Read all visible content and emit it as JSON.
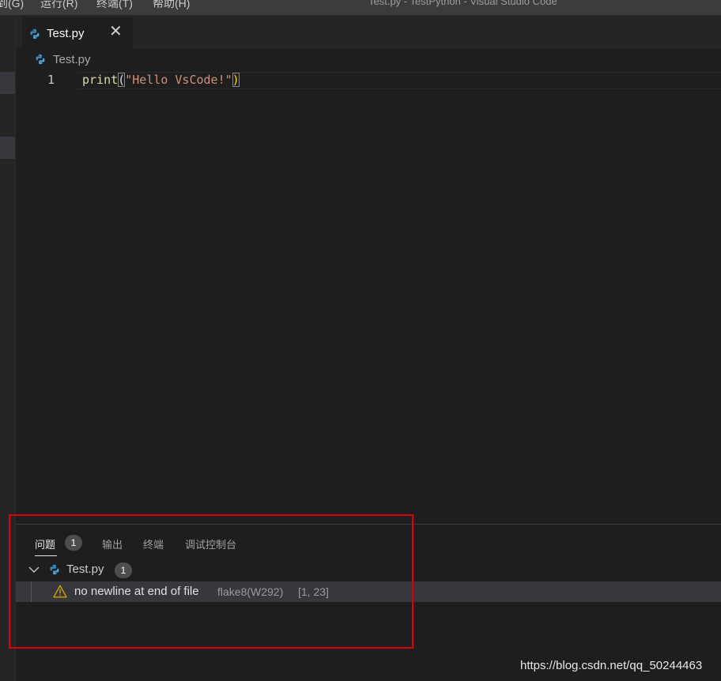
{
  "window": {
    "title": "Test.py - TestPython - Visual Studio Code"
  },
  "menu": {
    "items": [
      "到(G)",
      "运行(R)",
      "终端(T)",
      "帮助(H)"
    ]
  },
  "tabs": [
    {
      "label": "Test.py",
      "icon": "python-icon",
      "close": "✕"
    }
  ],
  "breadcrumb": {
    "file": "Test.py",
    "icon": "python-icon"
  },
  "editor": {
    "line_number": "1",
    "code": {
      "fn": "print",
      "open": "(",
      "str": "\"Hello VsCode!\"",
      "close": ")"
    },
    "colors": {
      "function": "#dcdcaa",
      "string": "#ce9178",
      "bracket_match": "#ffd700"
    }
  },
  "panel": {
    "tabs": [
      {
        "label": "问题",
        "badge": "1",
        "active": true
      },
      {
        "label": "输出"
      },
      {
        "label": "终端"
      },
      {
        "label": "调试控制台"
      }
    ],
    "file_group": {
      "label": "Test.py",
      "count": "1",
      "expanded": true
    },
    "problems": [
      {
        "severity": "warning",
        "message": "no newline at end of file",
        "source": "flake8(W292)",
        "position": "[1, 23]"
      }
    ]
  },
  "watermark": "https://blog.csdn.net/qq_50244463",
  "annotation_color": "#e00000"
}
